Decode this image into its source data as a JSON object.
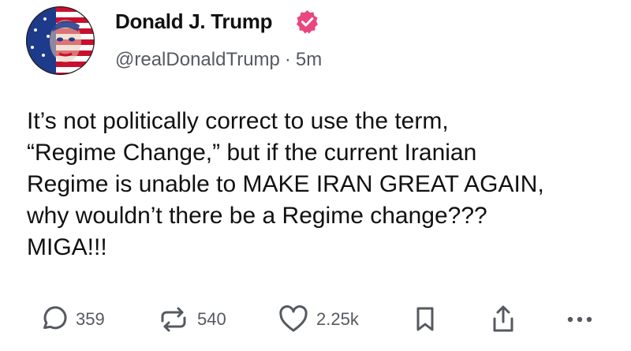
{
  "post": {
    "author": {
      "display_name": "Donald J. Trump",
      "verified": true,
      "verified_color": "#e9477f",
      "handle": "@realDonaldTrump",
      "separator": "·",
      "time_ago": "5m"
    },
    "body_lines": [
      "It’s not politically correct to use the term,",
      "“Regime Change,” but if the current Iranian",
      "Regime is unable to MAKE IRAN GREAT AGAIN,",
      "why wouldn’t there be a Regime change???",
      "MIGA!!!"
    ],
    "actions": {
      "reply": {
        "icon": "speech-bubble-icon",
        "count": "359"
      },
      "repost": {
        "icon": "repost-arrows-icon",
        "count": "540"
      },
      "like": {
        "icon": "heart-icon",
        "count": "2.25k"
      },
      "bookmark": {
        "icon": "bookmark-icon"
      },
      "share": {
        "icon": "share-upload-icon"
      },
      "more": {
        "icon": "ellipsis-icon"
      }
    }
  },
  "colors": {
    "text": "#111111",
    "secondary_text": "#555a60",
    "icon": "#555a60",
    "avatar_red": "#c8102e",
    "avatar_blue": "#1e3a8a"
  }
}
